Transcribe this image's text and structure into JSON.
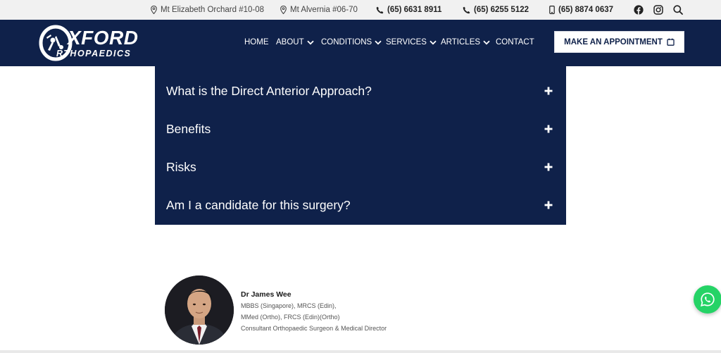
{
  "topbar": {
    "locations": [
      "Mt Elizabeth Orchard #10-08",
      "Mt Alvernia #06-70"
    ],
    "phones": [
      "(65) 6631 8911",
      "(65) 6255 5122"
    ],
    "mobile": "(65) 8874 0637",
    "social_icons": [
      "facebook-icon",
      "instagram-icon",
      "search-icon"
    ]
  },
  "header": {
    "logo_line1": "XFORD",
    "logo_line2": "RTHOPAEDICS",
    "nav": {
      "home": "HOME",
      "about": "ABOUT",
      "conditions": "CONDITIONS",
      "services": "SERVICES",
      "articles": "ARTICLES",
      "contact": "CONTACT"
    },
    "appointment": "MAKE AN APPOINTMENT"
  },
  "accordion": [
    {
      "question": "What is the Direct Anterior Approach?"
    },
    {
      "question": "Benefits"
    },
    {
      "question": "Risks"
    },
    {
      "question": "Am I a candidate for this surgery?"
    }
  ],
  "doctor": {
    "name": "Dr James Wee",
    "credentials1": "MBBS (Singapore), MRCS (Edin),",
    "credentials2": "MMed (Ortho), FRCS (Edin)(Ortho)",
    "title": "Consultant Orthopaedic Surgeon & Medical Director"
  },
  "colors": {
    "navy": "#0f214a",
    "whatsapp": "#25d366",
    "topbar_bg": "#f1f1f1"
  }
}
